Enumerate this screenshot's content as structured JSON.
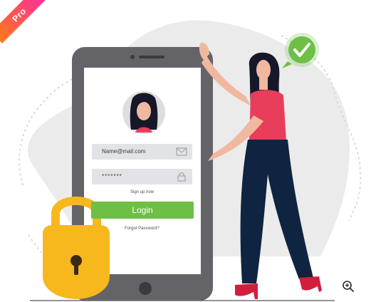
{
  "badge": {
    "label": "Pro"
  },
  "login_form": {
    "email_placeholder": "Name@mail.com",
    "password_value": "*******",
    "signup_link": "Sign up now",
    "login_button": "Login",
    "forgot_link": "Forgot Password?"
  },
  "icons": {
    "email": "mail-icon",
    "password": "padlock-icon",
    "success": "check-icon",
    "zoom": "zoom-in-icon",
    "lock": "lock-icon"
  },
  "colors": {
    "phone_body": "#646368",
    "login_button": "#6dbf45",
    "lock": "#f7b81e",
    "check_badge": "#6dbf45",
    "woman_top": "#e83e5b",
    "woman_pants": "#0f2440",
    "heels": "#d21e3c",
    "background_blob": "#ebebeb"
  }
}
